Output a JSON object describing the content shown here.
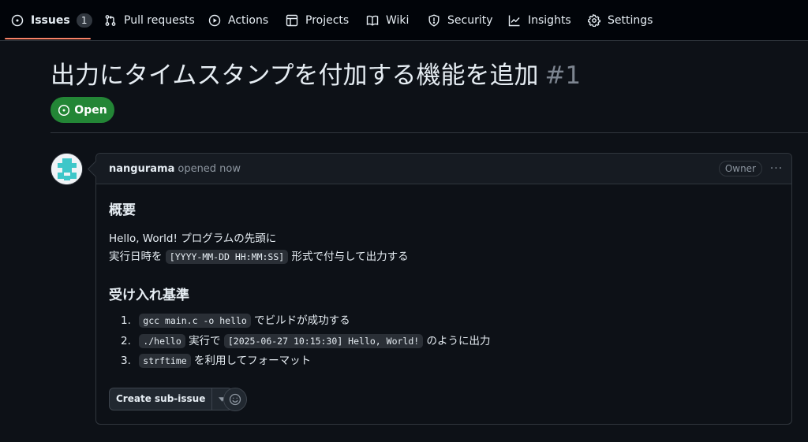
{
  "nav": {
    "items": [
      {
        "label": "Issues",
        "icon": "issue-opened-icon",
        "counter": "1",
        "selected": true
      },
      {
        "label": "Pull requests",
        "icon": "git-pull-request-icon"
      },
      {
        "label": "Actions",
        "icon": "play-icon"
      },
      {
        "label": "Projects",
        "icon": "table-icon"
      },
      {
        "label": "Wiki",
        "icon": "book-icon"
      },
      {
        "label": "Security",
        "icon": "shield-icon"
      },
      {
        "label": "Insights",
        "icon": "graph-icon"
      },
      {
        "label": "Settings",
        "icon": "gear-icon"
      }
    ]
  },
  "issue": {
    "title": "出力にタイムスタンプを付加する機能を追加",
    "number": "#1",
    "state": "Open"
  },
  "comment": {
    "author": "nangurama",
    "opened": "opened now",
    "role_badge": "Owner",
    "more": "···",
    "summary_heading": "概要",
    "para_line1": "Hello, World! プログラムの先頭に",
    "para_line2_pre": "実行日時を",
    "para_line2_code": "[YYYY-MM-DD HH:MM:SS]",
    "para_line2_post": "形式で付与して出力する",
    "criteria_heading": "受け入れ基準",
    "criteria": [
      {
        "num": "1.",
        "code": "gcc main.c -o hello",
        "text": "でビルドが成功する"
      },
      {
        "num": "2.",
        "code": "./hello",
        "mid": "実行で",
        "code2": "[2025-06-27 10:15:30] Hello, World!",
        "text": "のように出力"
      },
      {
        "num": "3.",
        "code": "strftime",
        "text": "を利用してフォーマット"
      }
    ],
    "create_subissue": "Create sub-issue"
  },
  "colors": {
    "background": "#0d1117",
    "nav_background": "#010409",
    "accent_underline": "#f78166",
    "open_state": "#238636",
    "border": "#30363d",
    "muted_text": "#8d96a0"
  }
}
